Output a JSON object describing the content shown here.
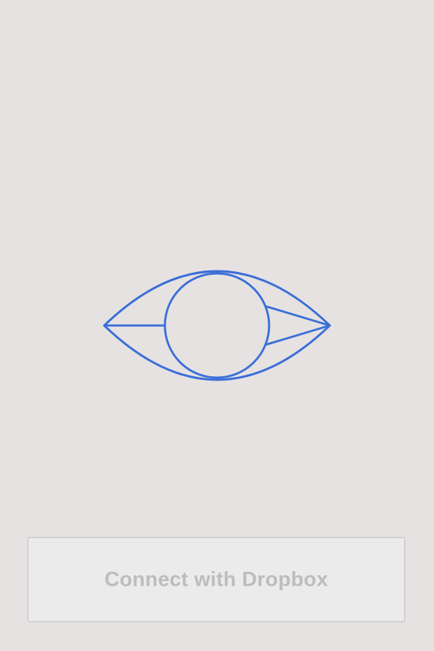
{
  "logo": {
    "icon": "eye-icon",
    "stroke_color": "#3b6fd8"
  },
  "connect_button": {
    "label": "Connect with Dropbox",
    "state": "disabled"
  },
  "colors": {
    "background": "#e6e2e2",
    "button_background": "#ebebeb",
    "button_text": "#bdbdbd"
  }
}
